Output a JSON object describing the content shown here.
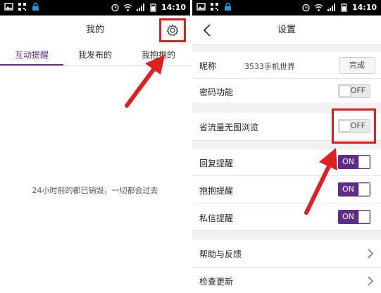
{
  "status_bar": {
    "time": "14:10",
    "left_icons": [
      "image-icon",
      "qr-icon",
      "lock-app-icon"
    ],
    "right_icons": [
      "alarm-icon",
      "wifi-icon",
      "signal-icon",
      "battery-icon"
    ]
  },
  "left_screen": {
    "title": "我的",
    "tabs": [
      "互动提醒",
      "我发布的",
      "我抱抱的"
    ],
    "empty_message": "24小时前的都已销毁，一切都会过去"
  },
  "right_screen": {
    "title": "设置",
    "nickname_label": "昵称",
    "nickname_value": "3533手机世界",
    "done_label": "完成",
    "password_label": "密码功能",
    "password_toggle": "OFF",
    "data_saver_label": "省流量无图浏览",
    "data_saver_toggle": "OFF",
    "reply_label": "回复提醒",
    "reply_toggle": "ON",
    "hug_label": "抱抱提醒",
    "hug_toggle": "ON",
    "message_label": "私信提醒",
    "message_toggle": "ON",
    "help_label": "帮助与反馈",
    "update_label": "检查更新"
  },
  "colors": {
    "accent_purple": "#5e2d8c",
    "highlight_red": "#e02020",
    "status_bar": "#000000"
  }
}
